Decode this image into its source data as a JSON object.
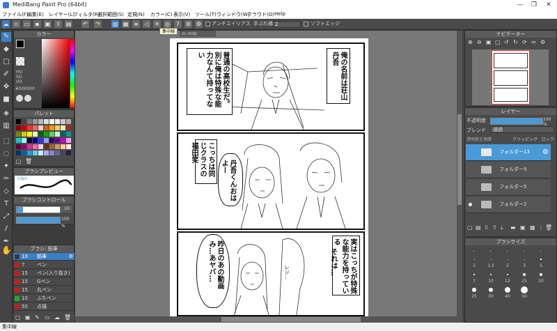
{
  "window": {
    "title": "MediBang Paint Pro (64bit)",
    "min": "—",
    "restore": "❐",
    "close": "✕"
  },
  "menu": [
    "ファイル(F)",
    "編集(E)",
    "レイヤー(L)",
    "フィルタ(R)",
    "選択範囲(S)",
    "定規(N)",
    "カラー(C)",
    "表示(V)",
    "ツール(T)",
    "ウィンドウ(W)",
    "クラウド(O)",
    "Help"
  ],
  "toolbar": {
    "antialias_label": "アンチエイリアス",
    "stabilizer_label": "手ぶれ補正",
    "stabilizer_value": "2",
    "soft_edge_label": "ソフトエッジ",
    "tooltip": "集中線"
  },
  "document_tab": "zc.mdp",
  "panels": {
    "color": {
      "title": "カラー",
      "hex": "#000000",
      "hsv": [
        "HO",
        "SO",
        "VO"
      ]
    },
    "palette": {
      "title": "パレット"
    },
    "brush_preview": {
      "title": "ブラシプレビュー",
      "size": "10px"
    },
    "brush_control": {
      "title": "ブラシコントロール",
      "size_value": "10",
      "opacity_value": "100 %",
      "opacity_fraction": 1.0,
      "size_fraction": 0.15
    },
    "brush": {
      "title": "ブラシ: 鉛筆",
      "items": [
        {
          "size": "10",
          "name": "鉛筆",
          "color": "#3a3a3a",
          "selected": true
        },
        {
          "size": "7",
          "name": "ペン",
          "color": "#cc1a1a"
        },
        {
          "size": "15",
          "name": "ペン(入り抜き)",
          "color": "#cc1a1a"
        },
        {
          "size": "15",
          "name": "Gペン",
          "color": "#cc1a1a"
        },
        {
          "size": "15",
          "name": "丸ペン",
          "color": "#cc1a1a"
        },
        {
          "size": "10",
          "name": "ふちペン",
          "color": "#22aa22"
        },
        {
          "size": "50",
          "name": "点描",
          "color": "#cc1a1a"
        }
      ]
    },
    "navigator": {
      "title": "ナビゲーター"
    },
    "layer": {
      "title": "レイヤー",
      "opacity_label": "不透明度",
      "opacity_value": "100 %",
      "opacity_fraction": 1.0,
      "blend_label": "ブレンド",
      "blend_value": "通過",
      "protect_label": "透明度を保護",
      "clipping_label": "クリッピング",
      "lock_label": "ロック",
      "layers": [
        {
          "name": "フォルダー13",
          "selected": true
        },
        {
          "name": "フォルダー9"
        },
        {
          "name": "フォルダー5"
        },
        {
          "name": "フォルダー2",
          "dot": true
        }
      ]
    },
    "brush_size": {
      "title": "ブラシサイズ",
      "sizes": [
        "1",
        "1.5",
        "2",
        "3",
        "5",
        "7",
        "10",
        "12",
        "15",
        "20",
        "25",
        "30",
        "40",
        "50"
      ]
    }
  },
  "manga": {
    "panel1": {
      "caption_right": "俺の名前は荘山丹吾",
      "caption_left": "普通の高校生だ。別に俺は特殊な能力なんて持ってない"
    },
    "panel2": {
      "caption_right": "こっちは同じクラスの福田笑",
      "speech": "丹吾くんおはよー"
    },
    "panel3": {
      "caption_right": "実はこっちが特殊な能力を持っている",
      "caption_mid": "それは…",
      "speech": "昨日のあの動画み…あヤバ…",
      "sfx": "レジ…"
    }
  },
  "status": "集中線"
}
